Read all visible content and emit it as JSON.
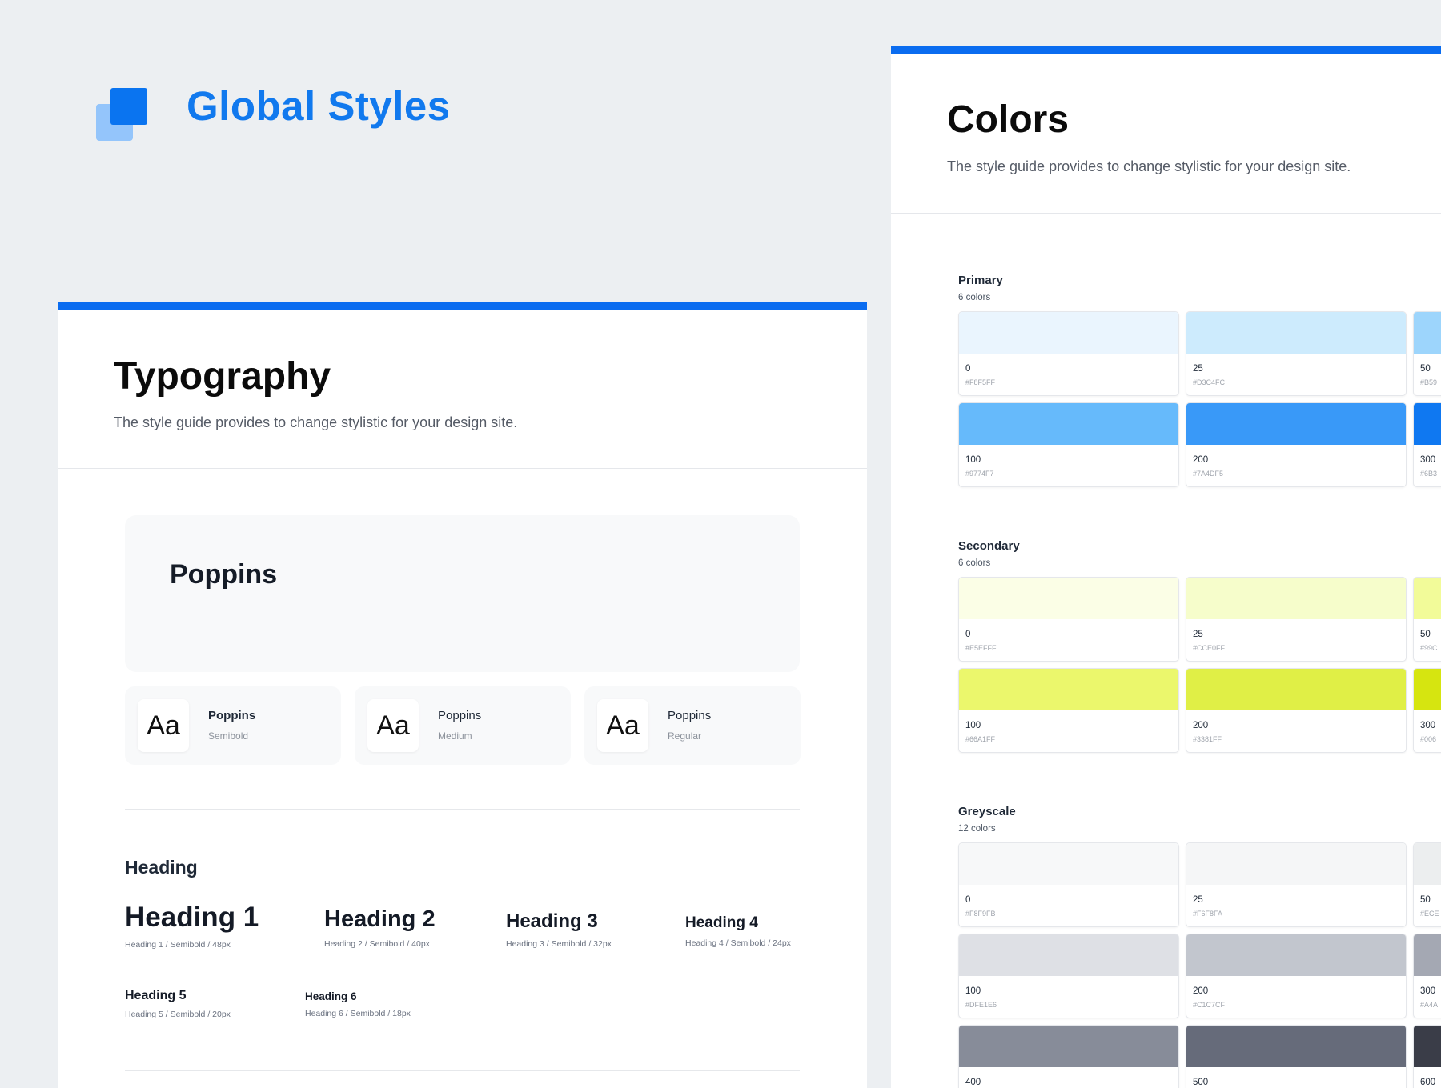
{
  "app": {
    "title": "Global Styles"
  },
  "typography": {
    "title": "Typography",
    "subtitle": "The style guide provides to change stylistic for your design site.",
    "font_family": "Poppins",
    "weights": [
      {
        "sample": "Aa",
        "family": "Poppins",
        "style": "Semibold"
      },
      {
        "sample": "Aa",
        "family": "Poppins",
        "style": "Medium"
      },
      {
        "sample": "Aa",
        "family": "Poppins",
        "style": "Regular"
      }
    ],
    "heading_section": "Heading",
    "headings": [
      {
        "label": "Heading 1",
        "meta": "Heading 1 / Semibold / 48px"
      },
      {
        "label": "Heading 2",
        "meta": "Heading 2 / Semibold / 40px"
      },
      {
        "label": "Heading 3",
        "meta": "Heading 3 / Semibold / 32px"
      },
      {
        "label": "Heading 4",
        "meta": "Heading 4 / Semibold / 24px"
      },
      {
        "label": "Heading 5",
        "meta": "Heading 5 / Semibold / 20px"
      },
      {
        "label": "Heading 6",
        "meta": "Heading 6 / Semibold / 18px"
      }
    ]
  },
  "colors": {
    "title": "Colors",
    "subtitle": "The style guide provides to change stylistic for your design site.",
    "palettes": [
      {
        "name": "Primary",
        "count": "6 colors",
        "swatches": [
          {
            "name": "0",
            "hex": "#F8F5FF",
            "color": "#EAF5FE"
          },
          {
            "name": "25",
            "hex": "#D3C4FC",
            "color": "#CDEBFD"
          },
          {
            "name": "50",
            "hex": "#B59",
            "color": "#9DD5FC"
          },
          {
            "name": "100",
            "hex": "#9774F7",
            "color": "#66BAFB"
          },
          {
            "name": "200",
            "hex": "#7A4DF5",
            "color": "#3999F8"
          },
          {
            "name": "300",
            "hex": "#6B3",
            "color": "#0F78F1"
          }
        ]
      },
      {
        "name": "Secondary",
        "count": "6 colors",
        "swatches": [
          {
            "name": "0",
            "hex": "#E5EFFF",
            "color": "#FBFEE6"
          },
          {
            "name": "25",
            "hex": "#CCE0FF",
            "color": "#F6FDCB"
          },
          {
            "name": "50",
            "hex": "#99C",
            "color": "#F2FB99"
          },
          {
            "name": "100",
            "hex": "#66A1FF",
            "color": "#EBF76C"
          },
          {
            "name": "200",
            "hex": "#3381FF",
            "color": "#E0EF46"
          },
          {
            "name": "300",
            "hex": "#006",
            "color": "#D6E510"
          }
        ]
      },
      {
        "name": "Greyscale",
        "count": "12 colors",
        "swatches": [
          {
            "name": "0",
            "hex": "#F8F9FB",
            "color": "#F7F8F9"
          },
          {
            "name": "25",
            "hex": "#F6F8FA",
            "color": "#F5F6F7"
          },
          {
            "name": "50",
            "hex": "#ECE",
            "color": "#ECEEEF"
          },
          {
            "name": "100",
            "hex": "#DFE1E6",
            "color": "#DEE0E5"
          },
          {
            "name": "200",
            "hex": "#C1C7CF",
            "color": "#C2C6CE"
          },
          {
            "name": "300",
            "hex": "#A4A",
            "color": "#A4A8B3"
          },
          {
            "name": "400",
            "hex": "",
            "color": "#878C99"
          },
          {
            "name": "500",
            "hex": "",
            "color": "#666B7A"
          },
          {
            "name": "600",
            "hex": "",
            "color": "#3A3D48"
          }
        ]
      }
    ]
  },
  "theme": {
    "accent": "#0A6CF0",
    "background": "#ECEFF2"
  }
}
